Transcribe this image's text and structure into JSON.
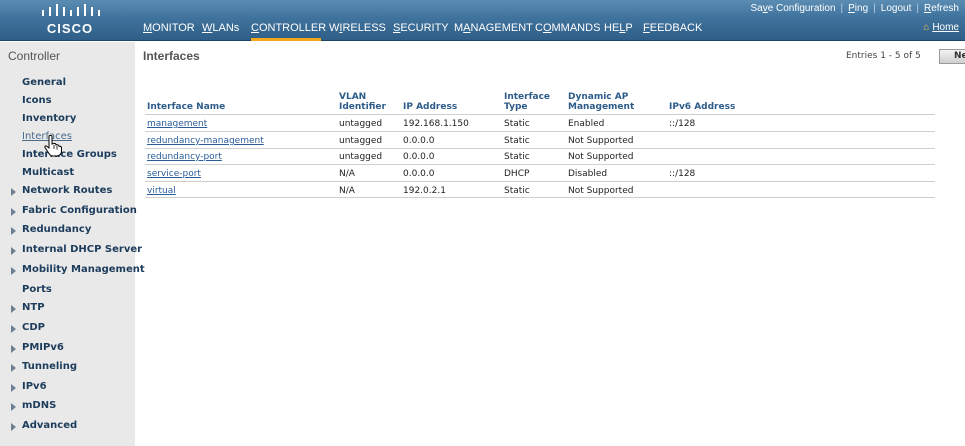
{
  "header": {
    "logo_text": "CISCO",
    "utility_links": [
      {
        "pre": "Sa",
        "u": "v",
        "post": "e Configuration"
      },
      {
        "pre": "",
        "u": "P",
        "post": "ing"
      },
      {
        "pre": "Logout",
        "u": "",
        "post": ""
      },
      {
        "pre": "",
        "u": "R",
        "post": "efresh"
      }
    ],
    "nav": [
      {
        "pre": "",
        "u": "M",
        "post": "ONITOR"
      },
      {
        "pre": "",
        "u": "W",
        "post": "LANs"
      },
      {
        "pre": "",
        "u": "C",
        "post": "ONTROLLER"
      },
      {
        "pre": "W",
        "u": "I",
        "post": "RELESS"
      },
      {
        "pre": "",
        "u": "S",
        "post": "ECURITY"
      },
      {
        "pre": "M",
        "u": "A",
        "post": "NAGEMENT"
      },
      {
        "pre": "C",
        "u": "O",
        "post": "MMANDS"
      },
      {
        "pre": "HE",
        "u": "L",
        "post": "P"
      },
      {
        "pre": "",
        "u": "F",
        "post": "EEDBACK"
      }
    ],
    "home_label": "Home",
    "accent_color": "#f2a71c"
  },
  "sidebar": {
    "title": "Controller",
    "items": [
      {
        "label": "General",
        "expandable": false
      },
      {
        "label": "Icons",
        "expandable": false
      },
      {
        "label": "Inventory",
        "expandable": false
      },
      {
        "label": "Interfaces",
        "expandable": false,
        "active": true
      },
      {
        "label": "Interface Groups",
        "expandable": false
      },
      {
        "label": "Multicast",
        "expandable": false
      },
      {
        "label": "Network Routes",
        "expandable": true
      },
      {
        "label": "Fabric Configuration",
        "expandable": true
      },
      {
        "label": "Redundancy",
        "expandable": true
      },
      {
        "label": "Internal DHCP Server",
        "expandable": true
      },
      {
        "label": "Mobility Management",
        "expandable": true
      },
      {
        "label": "Ports",
        "expandable": false
      },
      {
        "label": "NTP",
        "expandable": true
      },
      {
        "label": "CDP",
        "expandable": true
      },
      {
        "label": "PMIPv6",
        "expandable": true
      },
      {
        "label": "Tunneling",
        "expandable": true
      },
      {
        "label": "IPv6",
        "expandable": true
      },
      {
        "label": "mDNS",
        "expandable": true
      },
      {
        "label": "Advanced",
        "expandable": true
      }
    ]
  },
  "main": {
    "title": "Interfaces",
    "entries": "Entries 1 - 5 of 5",
    "new_button": "Ne",
    "table": {
      "columns": [
        {
          "l1": "",
          "l2": "Interface Name"
        },
        {
          "l1": "VLAN",
          "l2": "Identifier"
        },
        {
          "l1": "",
          "l2": "IP Address"
        },
        {
          "l1": "Interface",
          "l2": "Type"
        },
        {
          "l1": "Dynamic AP",
          "l2": "Management"
        },
        {
          "l1": "",
          "l2": "IPv6 Address"
        }
      ],
      "rows": [
        [
          "management",
          "untagged",
          "192.168.1.150",
          "Static",
          "Enabled",
          "::/128"
        ],
        [
          "redundancy-management",
          "untagged",
          "0.0.0.0",
          "Static",
          "Not Supported",
          ""
        ],
        [
          "redundancy-port",
          "untagged",
          "0.0.0.0",
          "Static",
          "Not Supported",
          ""
        ],
        [
          "service-port",
          "N/A",
          "0.0.0.0",
          "DHCP",
          "Disabled",
          "::/128"
        ],
        [
          "virtual",
          "N/A",
          "192.0.2.1",
          "Static",
          "Not Supported",
          ""
        ]
      ]
    }
  }
}
